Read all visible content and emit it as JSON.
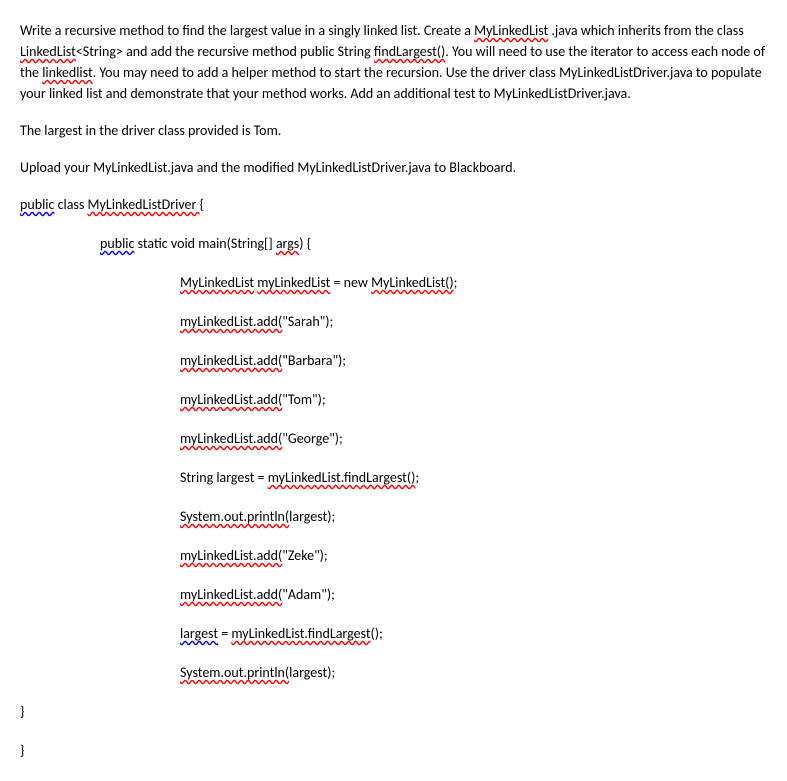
{
  "intro": {
    "p1_a": "Write a recursive method to find the largest value in a singly linked list.  Create a ",
    "p1_b": "MyLinkedList",
    "p1_c": " .java which inherits from the class ",
    "p1_d": "LinkedList",
    "p1_e": "<String> and add the recursive method public String ",
    "p1_f": "findLargest()",
    "p1_g": ".  You will need to use the iterator to access each node of the ",
    "p1_h": "linkedlist",
    "p1_i": ".  You may need to add a helper method to start the recursion.  Use the driver class MyLinkedListDriver.java to populate your linked list and demonstrate that your method works. Add an additional test to MyLinkedListDriver.java.",
    "p2": "The largest in the driver class provided is Tom.",
    "p3": "Upload your MyLinkedList.java and the modified MyLinkedListDriver.java to Blackboard."
  },
  "code": {
    "l1_a": "public",
    "l1_b": " class ",
    "l1_c": "MyLinkedListDriver ",
    "l1_d": "{",
    "l2_a": "public",
    "l2_b": " static void main(String[] ",
    "l2_c": "args",
    "l2_d": ") {",
    "l3_a": "MyLinkedList",
    "l3_b": " ",
    "l3_c": "myLinkedList",
    "l3_d": " = new ",
    "l3_e": "MyLinkedList()",
    "l3_f": ";",
    "l4_a": "myLinkedList.add(",
    "l4_b": "\"Sarah\");",
    "l5_a": "myLinkedList.add(",
    "l5_b": "\"Barbara\");",
    "l6_a": "myLinkedList.add(",
    "l6_b": "\"Tom\");",
    "l7_a": "myLinkedList.add(",
    "l7_b": "\"George\");",
    "l8_a": "String largest = ",
    "l8_b": "myLinkedList.findLargest()",
    "l8_c": ";",
    "l9_a": "System.out.println(",
    "l9_b": "largest);",
    "l10_a": "myLinkedList.add(",
    "l10_b": "\"Zeke\");",
    "l11_a": "myLinkedList.add(",
    "l11_b": "\"Adam\");",
    "l12_a": "largest",
    "l12_b": " = ",
    "l12_c": "myLinkedList.findLargest",
    "l12_d": "();",
    "l13_a": "System.out.println(",
    "l13_b": "largest);",
    "close1": "}",
    "close2": "}"
  }
}
